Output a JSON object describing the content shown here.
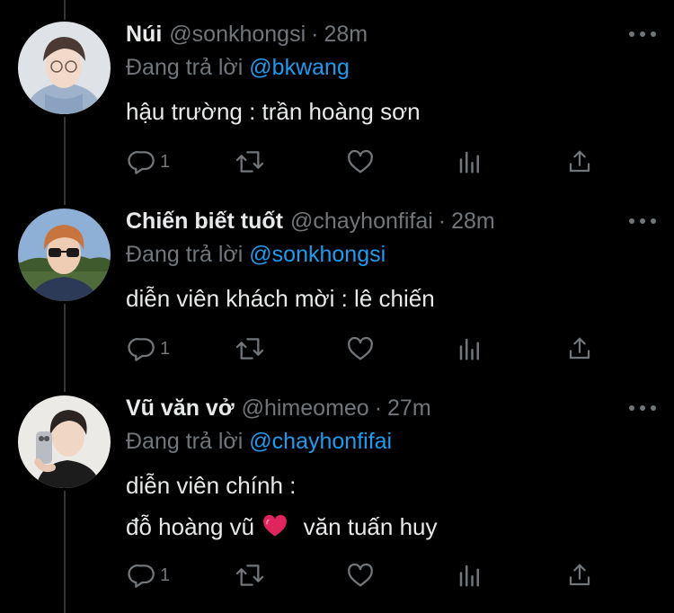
{
  "tweets": [
    {
      "name": "Núi",
      "handle": "@sonkhongsi",
      "time": "28m",
      "reply_prefix": "Đang trả lời",
      "reply_to": "@bkwang",
      "lines": [
        "hậu trường : trần hoàng sơn"
      ],
      "reply_count": "1"
    },
    {
      "name": "Chiến biết tuốt",
      "handle": "@chayhonfifai",
      "time": "28m",
      "reply_prefix": "Đang trả lời",
      "reply_to": "@sonkhongsi",
      "lines": [
        "diễn viên khách mời : lê chiến"
      ],
      "reply_count": "1"
    },
    {
      "name": "Vũ văn vở",
      "handle": "@himeomeo",
      "time": "27m",
      "reply_prefix": "Đang trả lời",
      "reply_to": "@chayhonfifai",
      "lines": [
        "diễn viên chính :",
        "đỗ hoàng vũ",
        "văn tuấn huy"
      ],
      "reply_count": "1"
    }
  ],
  "separator": "·",
  "icons": [
    "reply-icon",
    "retweet-icon",
    "like-icon",
    "analytics-icon",
    "share-icon",
    "more-icon",
    "heart-emoji"
  ],
  "colors": {
    "background": "#000000",
    "text": "#e7e9ea",
    "muted": "#71767b",
    "link": "#1d9bf0",
    "heart": "#e0245e"
  }
}
